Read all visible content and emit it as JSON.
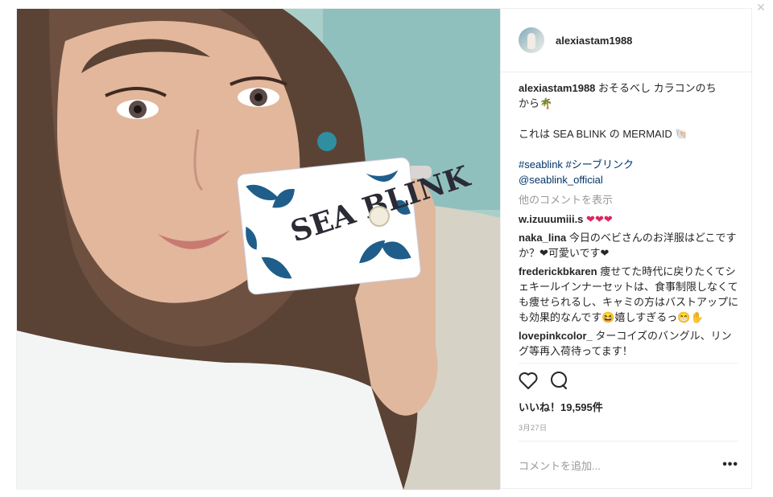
{
  "post": {
    "username": "alexiastam1988",
    "caption": {
      "user": "alexiastam1988",
      "line1": "おそるべし カラコンのち",
      "line2": "から🌴",
      "line3": "これは SEA BLINK の MERMAID 🐚",
      "hashtags": "#seablink #シーブリンク",
      "mention": "@seablink_official"
    },
    "more_comments": "他のコメントを表示",
    "comments": [
      {
        "user": "w.izuuumiii.s",
        "text": "❤❤❤"
      },
      {
        "user": "naka_lina",
        "text": "今日のベビさんのお洋服はどこですか？❤可愛いです❤"
      },
      {
        "user": "frederickbkaren",
        "text": "痩せてた時代に戻りたくてシェキールインナーセットは、食事制限しなくても痩せられるし、キャミの方はバストアップにも効果的なんです😆嬉しすぎるっ😁✋"
      },
      {
        "user": "lovepinkcolor_",
        "text": "ターコイズのバングル、リング等再入荷待ってます！"
      }
    ],
    "likes": "いいね！19,595件",
    "date": "3月27日",
    "add_comment_placeholder": "コメントを追加...",
    "more_options": "•••",
    "photo_text": "SEA BLINK",
    "icons": [
      "heart-icon",
      "comment-icon",
      "more-options-icon",
      "close-icon"
    ],
    "colors": {
      "link": "#003569",
      "muted": "#999999",
      "border": "#efefef"
    }
  }
}
